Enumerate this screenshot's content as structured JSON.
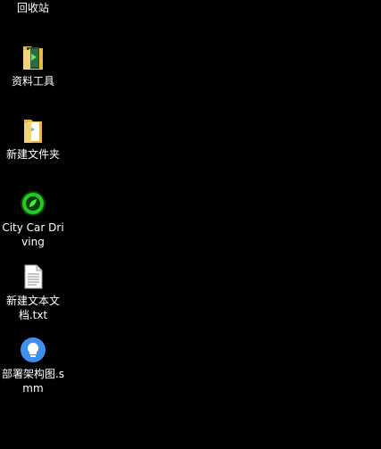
{
  "desktop": {
    "background": "#000000",
    "icons": [
      {
        "name": "recycle-bin",
        "label": "回收站",
        "icon": "recycle-bin-icon"
      },
      {
        "name": "tools-folder",
        "label": "资料工具",
        "icon": "folder-icon"
      },
      {
        "name": "new-folder",
        "label": "新建文件夹",
        "icon": "folder-icon"
      },
      {
        "name": "city-car-driving",
        "label": "City Car Driving",
        "icon": "city-car-driving-icon"
      },
      {
        "name": "new-text-file",
        "label": "新建文本文档.txt",
        "icon": "text-file-icon"
      },
      {
        "name": "smm-file",
        "label": "部署架构图.smm",
        "icon": "mindmap-file-icon"
      }
    ]
  }
}
